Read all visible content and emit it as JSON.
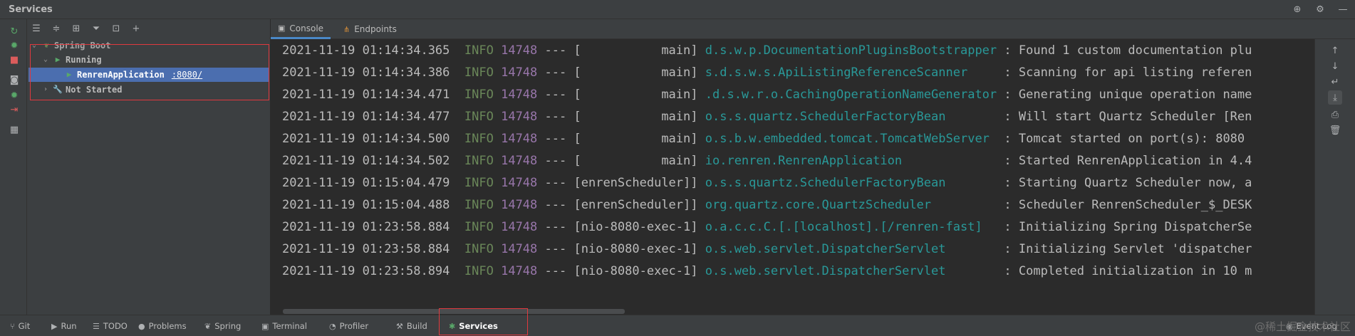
{
  "window": {
    "title": "Services"
  },
  "title_controls": [
    {
      "name": "crosshair-icon",
      "glyph": "⊕"
    },
    {
      "name": "gear-icon",
      "glyph": "⚙"
    },
    {
      "name": "minimize-icon",
      "glyph": "—"
    }
  ],
  "tree_toolbar": [
    {
      "name": "expand-all-icon",
      "glyph": "☰"
    },
    {
      "name": "collapse-all-icon",
      "glyph": "≑"
    },
    {
      "name": "group-icon",
      "glyph": "⊞"
    },
    {
      "name": "filter-icon",
      "glyph": "⏷"
    },
    {
      "name": "new-tab-icon",
      "glyph": "⊡"
    },
    {
      "name": "add-icon",
      "glyph": "+"
    }
  ],
  "tree": {
    "root": "Spring Boot",
    "running": "Running",
    "app": "RenrenApplication",
    "port": ":8080/",
    "not_started": "Not Started"
  },
  "tabs": [
    {
      "label": "Console",
      "icon": "console-icon"
    },
    {
      "label": "Endpoints",
      "icon": "endpoints-icon"
    }
  ],
  "log_lines": [
    {
      "ts": "2021-11-19 01:14:34.365",
      "level": "INFO",
      "pid": "14748",
      "sep": "---",
      "thread": "[           main]",
      "logger": "d.s.w.p.DocumentationPluginsBootstrapper",
      "msg": ": Found 1 custom documentation plu"
    },
    {
      "ts": "2021-11-19 01:14:34.386",
      "level": "INFO",
      "pid": "14748",
      "sep": "---",
      "thread": "[           main]",
      "logger": "s.d.s.w.s.ApiListingReferenceScanner    ",
      "msg": ": Scanning for api listing referen"
    },
    {
      "ts": "2021-11-19 01:14:34.471",
      "level": "INFO",
      "pid": "14748",
      "sep": "---",
      "thread": "[           main]",
      "logger": ".d.s.w.r.o.CachingOperationNameGenerator",
      "msg": ": Generating unique operation name"
    },
    {
      "ts": "2021-11-19 01:14:34.477",
      "level": "INFO",
      "pid": "14748",
      "sep": "---",
      "thread": "[           main]",
      "logger": "o.s.s.quartz.SchedulerFactoryBean       ",
      "msg": ": Will start Quartz Scheduler [Ren"
    },
    {
      "ts": "2021-11-19 01:14:34.500",
      "level": "INFO",
      "pid": "14748",
      "sep": "---",
      "thread": "[           main]",
      "logger": "o.s.b.w.embedded.tomcat.TomcatWebServer ",
      "msg": ": Tomcat started on port(s): 8080"
    },
    {
      "ts": "2021-11-19 01:14:34.502",
      "level": "INFO",
      "pid": "14748",
      "sep": "---",
      "thread": "[           main]",
      "logger": "io.renren.RenrenApplication             ",
      "msg": ": Started RenrenApplication in 4.4"
    },
    {
      "ts": "2021-11-19 01:15:04.479",
      "level": "INFO",
      "pid": "14748",
      "sep": "---",
      "thread": "[enrenScheduler]]",
      "logger": "o.s.s.quartz.SchedulerFactoryBean       ",
      "msg": ": Starting Quartz Scheduler now, a"
    },
    {
      "ts": "2021-11-19 01:15:04.488",
      "level": "INFO",
      "pid": "14748",
      "sep": "---",
      "thread": "[enrenScheduler]]",
      "logger": "org.quartz.core.QuartzScheduler         ",
      "msg": ": Scheduler RenrenScheduler_$_DESK"
    },
    {
      "ts": "2021-11-19 01:23:58.884",
      "level": "INFO",
      "pid": "14748",
      "sep": "---",
      "thread": "[nio-8080-exec-1]",
      "logger": "o.a.c.c.C.[.[localhost].[/renren-fast]  ",
      "msg": ": Initializing Spring DispatcherSe"
    },
    {
      "ts": "2021-11-19 01:23:58.884",
      "level": "INFO",
      "pid": "14748",
      "sep": "---",
      "thread": "[nio-8080-exec-1]",
      "logger": "o.s.web.servlet.DispatcherServlet       ",
      "msg": ": Initializing Servlet 'dispatcher"
    },
    {
      "ts": "2021-11-19 01:23:58.894",
      "level": "INFO",
      "pid": "14748",
      "sep": "---",
      "thread": "[nio-8080-exec-1]",
      "logger": "o.s.web.servlet.DispatcherServlet       ",
      "msg": ": Completed initialization in 10 m"
    }
  ],
  "right_toolbar": [
    {
      "name": "scroll-up-icon",
      "glyph": "↑"
    },
    {
      "name": "scroll-down-icon",
      "glyph": "↓"
    },
    {
      "name": "soft-wrap-icon",
      "glyph": "↵"
    },
    {
      "name": "scroll-to-end-icon",
      "glyph": "⤓",
      "active": true
    },
    {
      "name": "print-icon",
      "glyph": "⎙"
    },
    {
      "name": "trash-icon",
      "glyph": "🗑"
    }
  ],
  "bottom_tabs": [
    {
      "label": "Git",
      "icon": "git-icon",
      "glyph": "⑂"
    },
    {
      "label": "Run",
      "icon": "run-icon",
      "glyph": "▶"
    },
    {
      "label": "TODO",
      "icon": "todo-icon",
      "glyph": "☰"
    },
    {
      "label": "Problems",
      "icon": "problems-icon",
      "glyph": "●"
    },
    {
      "label": "Spring",
      "icon": "spring-icon",
      "glyph": "❦"
    },
    {
      "label": "Terminal",
      "icon": "terminal-icon",
      "glyph": "▣"
    },
    {
      "label": "Profiler",
      "icon": "profiler-icon",
      "glyph": "◔"
    },
    {
      "label": "Build",
      "icon": "build-icon",
      "glyph": "⚒"
    },
    {
      "label": "Services",
      "icon": "services-icon",
      "glyph": "✱",
      "active": true
    }
  ],
  "bottom_right": {
    "label": "Event Log"
  },
  "watermark": "@稀土掘金技术社区",
  "colors": {
    "selection": "#4b6eaf",
    "highlight_box": "#e0393e",
    "info": "#6a8759",
    "pid": "#9876aa",
    "logger": "#299999",
    "run_green": "#59a869"
  }
}
